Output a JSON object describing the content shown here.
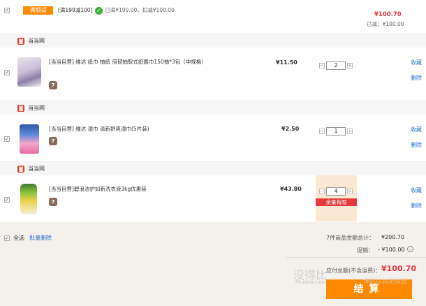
{
  "promo": {
    "tag": "满额减",
    "desc": "[满199减100]",
    "status": "已满¥199.00，扣减¥100.00",
    "total": "¥100.70",
    "saved": "已减：¥100.00"
  },
  "shops": [
    {
      "name": "当当网"
    },
    {
      "name": "当当网"
    },
    {
      "name": "当当网"
    }
  ],
  "items": [
    {
      "title": "[当当自营] 维达 纸巾 抽纸 倍韧抽取式纸面巾150抽*3包（中规格）",
      "badge": "7",
      "price": "¥11.50",
      "qty": "2",
      "collect": "收藏",
      "delete": "删除"
    },
    {
      "title": "[当当自营] 维达 湿巾 清新舒爽湿巾(5片装)",
      "badge": "7",
      "price": "¥2.50",
      "qty": "1",
      "collect": "收藏",
      "delete": "删除"
    },
    {
      "title": "[当当自营]碧浪洁护如新洗衣液3kg优惠装",
      "badge": "7",
      "price": "¥43.80",
      "qty": "4",
      "stock_warning": "余量有限",
      "collect": "收藏",
      "delete": "删除"
    }
  ],
  "footer": {
    "select_all": "全选",
    "batch_delete": "批量删除",
    "total_label": "7件商品金额总计：",
    "total_value": "¥200.70",
    "discount_label": "促销：",
    "discount_value": "- ¥100.00",
    "payable_label": "应付总额(不含运费)：",
    "payable_value": "¥100.70",
    "checkout": "结算"
  },
  "watermark": {
    "text": "没得比",
    "site": "Meidebi.com",
    "slogan": "谁能比我更便宜"
  },
  "colors": {
    "accent_orange": "#ff8a00",
    "price_red": "#e4393c",
    "link_blue": "#2a6ccb",
    "shop_red": "#e03e26",
    "badge_brown": "#8b6c5c"
  },
  "icons": {
    "shop": "store-icon",
    "check": "check-circle-icon",
    "qty_minus": "minus-icon",
    "qty_plus": "plus-icon",
    "discount_expand": "chevron-down-icon"
  }
}
